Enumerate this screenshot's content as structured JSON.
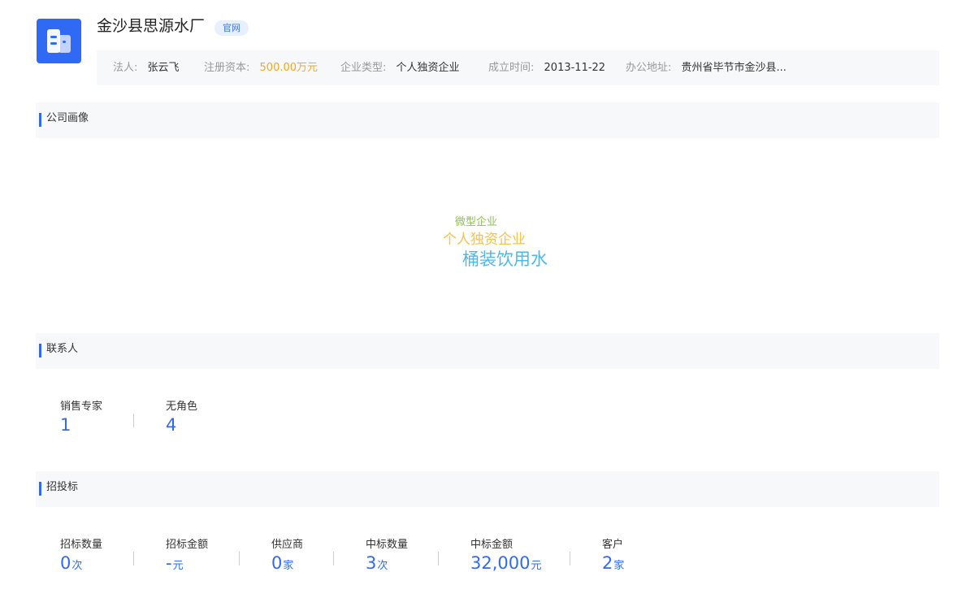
{
  "company": {
    "name": "金沙县思源水厂",
    "website_badge": "官网",
    "logo_icon": "building-icon",
    "logo_color": "#2f6af5"
  },
  "info": {
    "legal_rep_label": "法人:",
    "legal_rep_value": "张云飞",
    "capital_label": "注册资本:",
    "capital_value": "500.00万元",
    "type_label": "企业类型:",
    "type_value": "个人独资企业",
    "founded_label": "成立时间:",
    "founded_value": "2013-11-22",
    "address_label": "办公地址:",
    "address_value": "贵州省毕节市金沙县..."
  },
  "sections": {
    "profile": "公司画像",
    "contacts": "联系人",
    "bidding": "招投标"
  },
  "profile_tags": [
    {
      "text": "微型企业",
      "color": "#8cc152"
    },
    {
      "text": "个人独资企业",
      "color": "#f7c04a"
    },
    {
      "text": "桶装饮用水",
      "color": "#4fb8ea"
    }
  ],
  "contacts": [
    {
      "label": "销售专家",
      "value": "1"
    },
    {
      "label": "无角色",
      "value": "4"
    }
  ],
  "bidding": [
    {
      "label": "招标数量",
      "value": "0",
      "unit": "次"
    },
    {
      "label": "招标金额",
      "value": "-",
      "unit": "元"
    },
    {
      "label": "供应商",
      "value": "0",
      "unit": "家"
    },
    {
      "label": "中标数量",
      "value": "3",
      "unit": "次"
    },
    {
      "label": "中标金额",
      "value": "32,000",
      "unit": "元"
    },
    {
      "label": "客户",
      "value": "2",
      "unit": "家"
    }
  ],
  "accent_color": "#2f6af5"
}
